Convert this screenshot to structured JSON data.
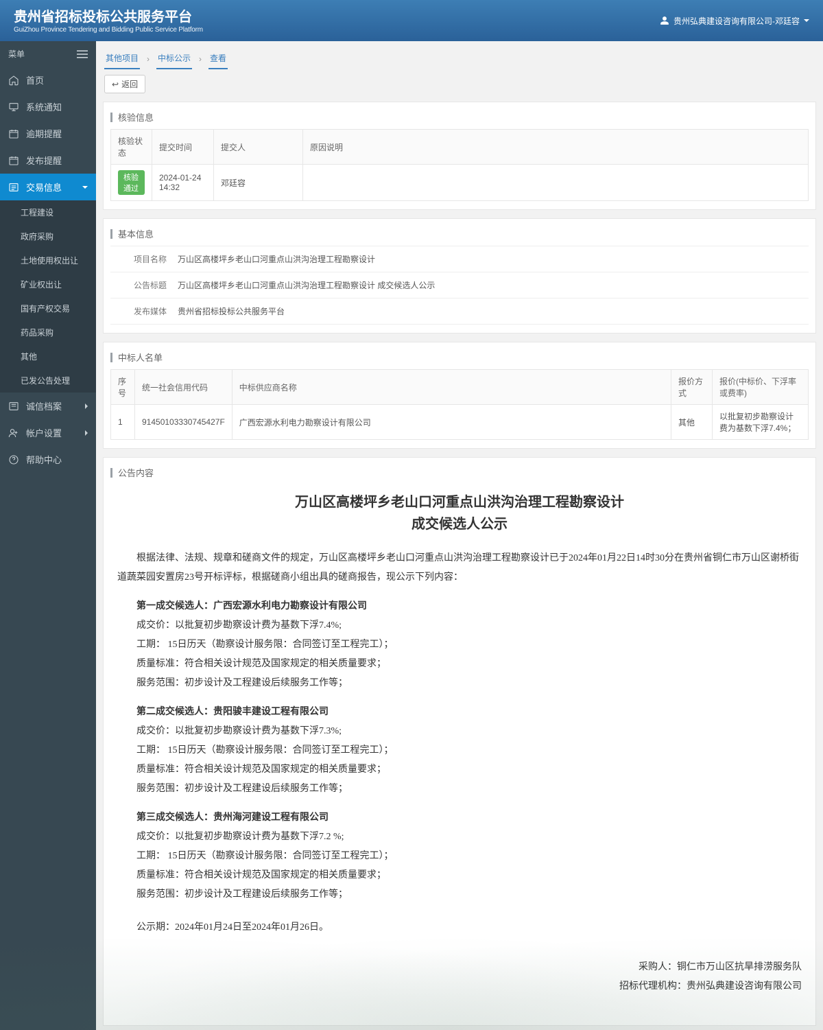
{
  "header": {
    "title": "贵州省招标投标公共服务平台",
    "subtitle": "GuiZhou Province Tendering and Bidding Public Service Platform",
    "user": "贵州弘典建设咨询有限公司-邓廷容"
  },
  "sidebar": {
    "menu_label": "菜单",
    "items": {
      "home": "首页",
      "notice": "系统通知",
      "overdue": "逾期提醒",
      "publish_remind": "发布提醒",
      "trade_info": "交易信息",
      "integrity": "诚信档案",
      "account": "帐户设置",
      "help": "帮助中心"
    },
    "trade_sub": {
      "construction": "工程建设",
      "gov": "政府采购",
      "land": "土地使用权出让",
      "mining": "矿业权出让",
      "state_assets": "国有产权交易",
      "medicine": "药品采购",
      "other": "其他",
      "published": "已发公告处理"
    }
  },
  "breadcrumb": {
    "a": "其他项目",
    "b": "中标公示",
    "c": "查看"
  },
  "toolbar": {
    "back": "返回"
  },
  "check_info": {
    "title": "核验信息",
    "headers": {
      "status": "核验状态",
      "time": "提交时间",
      "person": "提交人",
      "reason": "原因说明"
    },
    "row": {
      "status": "核验通过",
      "time": "2024-01-24 14:32",
      "person": "邓廷容",
      "reason": ""
    }
  },
  "basic_info": {
    "title": "基本信息",
    "labels": {
      "project": "项目名称",
      "ann_title": "公告标题",
      "media": "发布媒体"
    },
    "values": {
      "project": "万山区高楼坪乡老山口河重点山洪沟治理工程勘察设计",
      "ann_title": "万山区高楼坪乡老山口河重点山洪沟治理工程勘察设计 成交候选人公示",
      "media": "贵州省招标投标公共服务平台"
    }
  },
  "winners": {
    "title": "中标人名单",
    "headers": {
      "idx": "序号",
      "credit": "统一社会信用代码",
      "name": "中标供应商名称",
      "method": "报价方式",
      "price": "报价(中标价、下浮率或费率)"
    },
    "row": {
      "idx": "1",
      "credit": "91450103330745427F",
      "name": "广西宏源水利电力勘察设计有限公司",
      "method": "其他",
      "price": "以批复初步勘察设计费为基数下浮7.4%；"
    }
  },
  "announcement": {
    "title": "公告内容",
    "main_title_l1": "万山区高楼坪乡老山口河重点山洪沟治理工程勘察设计",
    "main_title_l2": "成交候选人公示",
    "intro": "根据法律、法规、规章和磋商文件的规定，万山区高楼坪乡老山口河重点山洪沟治理工程勘察设计已于2024年01月22日14时30分在贵州省铜仁市万山区谢桥街道蔬菜园安置房23号开标评标，根据磋商小组出具的磋商报告，现公示下列内容：",
    "c1": {
      "heading": "第一成交候选人：广西宏源水利电力勘察设计有限公司",
      "price": "成交价：以批复初步勘察设计费为基数下浮7.4%;",
      "duration": "工期： 15日历天（勘察设计服务限：合同签订至工程完工）；",
      "quality": "质量标准：符合相关设计规范及国家规定的相关质量要求；",
      "scope": "服务范围：初步设计及工程建设后续服务工作等；"
    },
    "c2": {
      "heading": "第二成交候选人：贵阳骏丰建设工程有限公司",
      "price": "成交价：以批复初步勘察设计费为基数下浮7.3%;",
      "duration": "工期： 15日历天（勘察设计服务限：合同签订至工程完工）；",
      "quality": "质量标准：符合相关设计规范及国家规定的相关质量要求；",
      "scope": "服务范围：初步设计及工程建设后续服务工作等；"
    },
    "c3": {
      "heading": "第三成交候选人：贵州海河建设工程有限公司",
      "price": "成交价：以批复初步勘察设计费为基数下浮7.2 %;",
      "duration": "工期： 15日历天（勘察设计服务限：合同签订至工程完工）；",
      "quality": "质量标准：符合相关设计规范及国家规定的相关质量要求；",
      "scope": "服务范围：初步设计及工程建设后续服务工作等；"
    },
    "period": "公示期：2024年01月24日至2024年01月26日。",
    "purchaser": "采购人：铜仁市万山区抗旱排涝服务队",
    "agency": "招标代理机构：贵州弘典建设咨询有限公司"
  }
}
